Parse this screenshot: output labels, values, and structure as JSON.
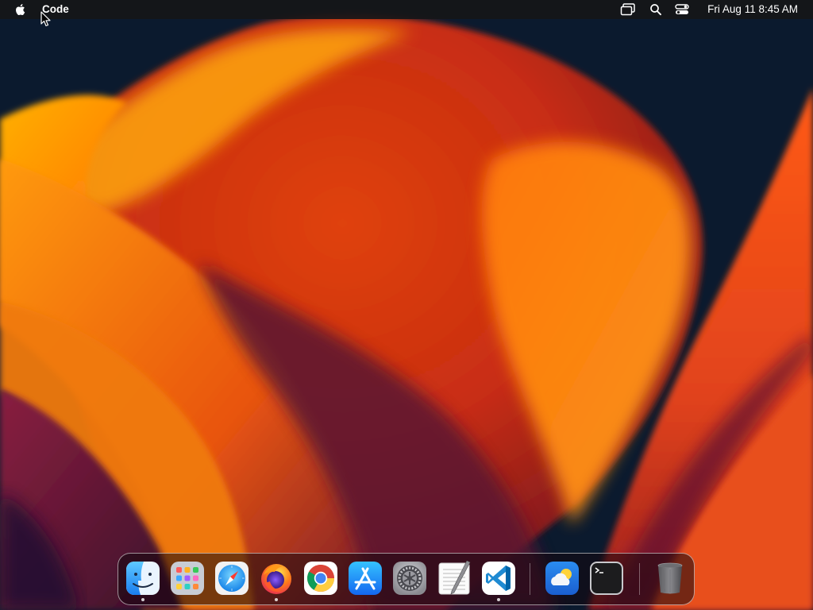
{
  "menubar": {
    "app_name": "Code",
    "clock": "Fri Aug 11  8:45 AM"
  },
  "icons": {
    "apple": "apple-icon",
    "screen_mirroring": "screen-mirroring-icon",
    "search": "search-icon",
    "control_center": "control-center-icon"
  },
  "dock": {
    "apps": [
      {
        "name": "Finder",
        "running": true
      },
      {
        "name": "Launchpad",
        "running": false
      },
      {
        "name": "Safari",
        "running": false
      },
      {
        "name": "Firefox",
        "running": true
      },
      {
        "name": "Chrome",
        "running": false
      },
      {
        "name": "App Store",
        "running": false
      },
      {
        "name": "System Settings",
        "running": false
      },
      {
        "name": "TextEdit",
        "running": false
      },
      {
        "name": "Visual Studio Code",
        "running": true
      },
      {
        "name": "Weather",
        "running": false
      },
      {
        "name": "Terminal",
        "running": false
      },
      {
        "name": "Trash",
        "running": false
      }
    ]
  },
  "colors": {
    "menubar_bg": "#161618",
    "wallpaper_dark": "#0b1a2e",
    "wallpaper_orange": "#ff8a0c",
    "wallpaper_red": "#d83a10",
    "wallpaper_purple": "#6a1a3e"
  }
}
